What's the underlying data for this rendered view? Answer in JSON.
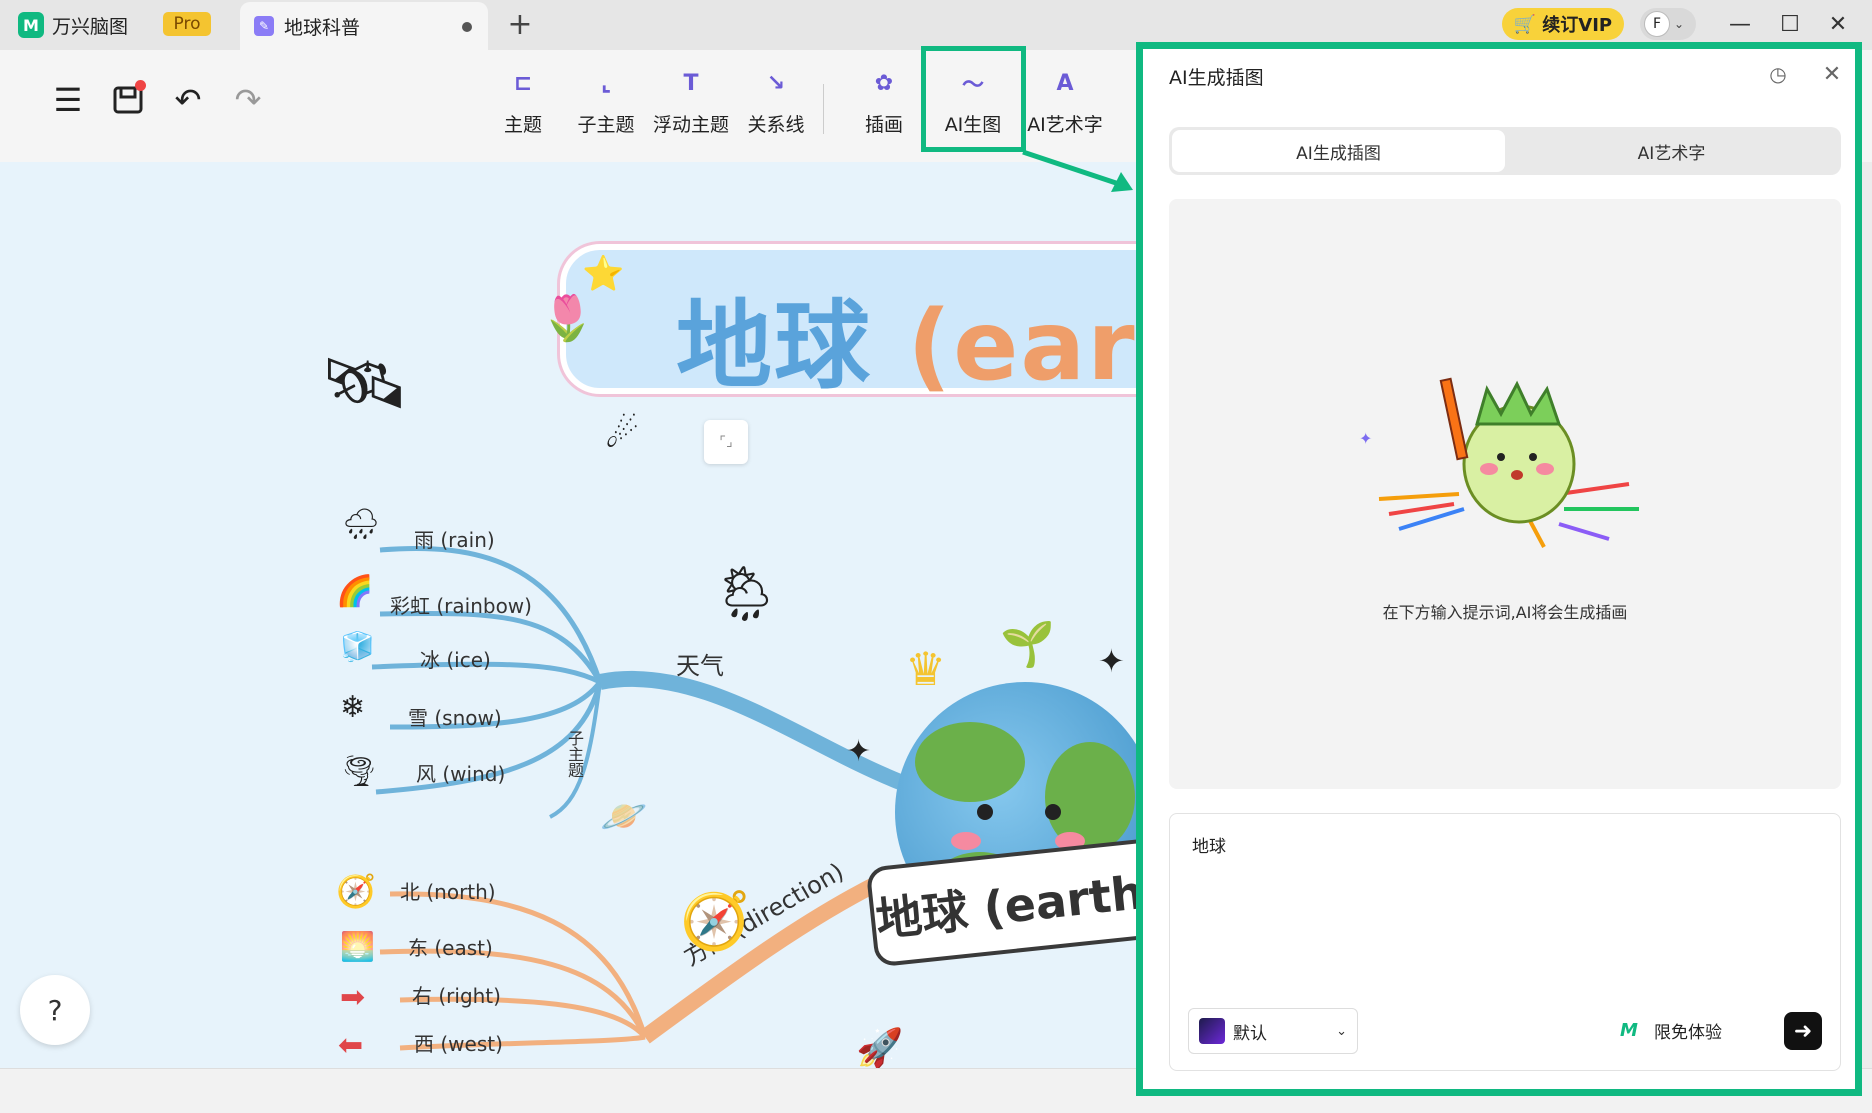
{
  "titlebar": {
    "app_name": "万兴脑图",
    "pro_badge": "Pro",
    "doc_tab": "地球科普",
    "vip_button": "续订VIP",
    "avatar_letter": "F"
  },
  "toolbar": {
    "tools": [
      {
        "label": "主题",
        "icon": "topic-icon"
      },
      {
        "label": "子主题",
        "icon": "subtopic-icon"
      },
      {
        "label": "浮动主题",
        "icon": "floating-topic-icon"
      },
      {
        "label": "关系线",
        "icon": "relation-line-icon"
      },
      {
        "label": "插画",
        "icon": "illustration-icon"
      },
      {
        "label": "AI生图",
        "icon": "ai-image-icon"
      },
      {
        "label": "AI艺术字",
        "icon": "ai-art-text-icon"
      }
    ]
  },
  "canvas": {
    "title_cn": "地球",
    "title_latin": "(eart",
    "branches_weather": [
      "雨 (rain)",
      "彩虹 (rainbow)",
      "冰 (ice)",
      "雪 (snow)",
      "风 (wind)"
    ],
    "weather_label": "天气",
    "subtopic_vertical": "子主题",
    "branches_direction": [
      "北 (north)",
      "东 (east)",
      "右 (right)",
      "西 (west)"
    ],
    "direction_label": "方向 (direction)",
    "earth_ribbon": "地球 (earth)"
  },
  "panel": {
    "title": "AI生成插图",
    "tabs": [
      "AI生成插图",
      "AI艺术字"
    ],
    "hint": "在下方输入提示词,AI将会生成插画",
    "prompt_value": "地球",
    "style_value": "默认",
    "free_label": "限免体验"
  },
  "colors": {
    "accent": "#10b981",
    "weather_branch": "#6fb3da",
    "direction_branch": "#f2b07f",
    "vip": "#f8d23a"
  }
}
